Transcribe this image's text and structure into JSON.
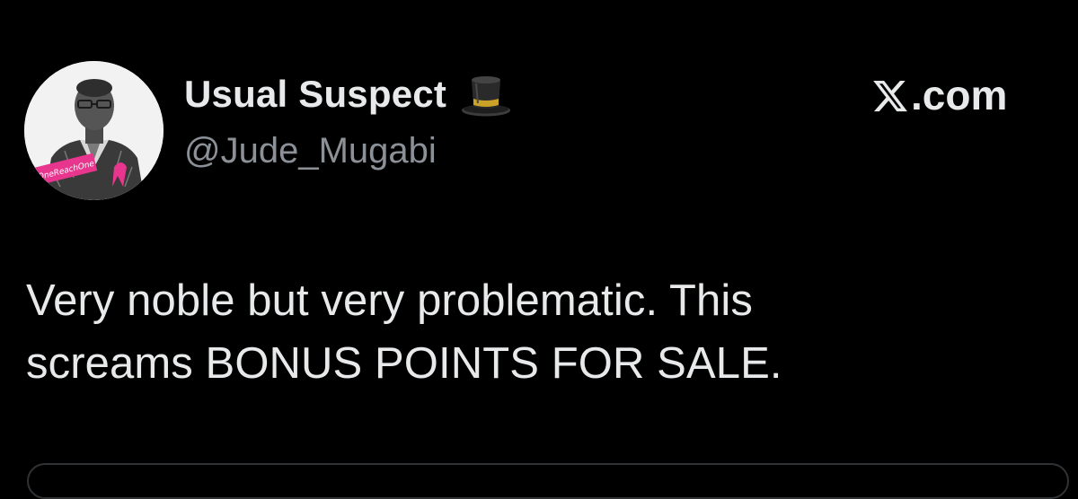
{
  "author": {
    "display_name": "Usual Suspect",
    "handle": "@Jude_Mugabi",
    "avatar_badge": "OneReachOne",
    "name_emoji_icon": "top-hat-icon"
  },
  "brand": {
    "logo_icon": "x-logo-icon",
    "suffix": ".com"
  },
  "tweet": {
    "lines": [
      "Very noble but very problematic. This",
      "screams BONUS POINTS FOR SALE."
    ]
  },
  "colors": {
    "background": "#000000",
    "primary_text": "#e7e9ea",
    "secondary_text": "#8b9197",
    "border": "#2f3336",
    "avatar_badge": "#e8358d"
  }
}
